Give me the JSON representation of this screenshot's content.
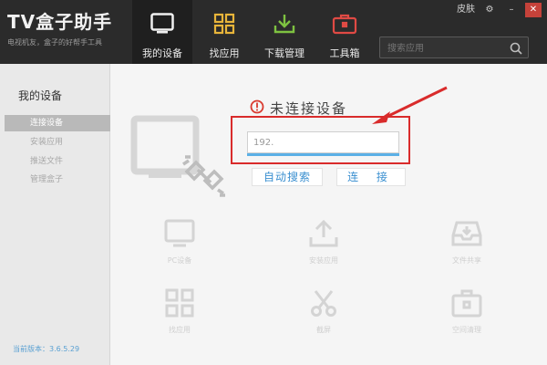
{
  "app": {
    "title": "TV盒子助手",
    "subtitle": "电视机友，盒子的好帮手工具"
  },
  "nav": {
    "tabs": [
      {
        "label": "我的设备",
        "icon": "monitor-icon"
      },
      {
        "label": "找应用",
        "icon": "apps-grid-icon"
      },
      {
        "label": "下载管理",
        "icon": "download-icon"
      },
      {
        "label": "工具箱",
        "icon": "toolbox-icon"
      }
    ],
    "active_tab": "我的设备"
  },
  "window_controls": {
    "skin_label": "皮肤",
    "settings": "⚙",
    "minimize": "–",
    "close": "✕"
  },
  "search": {
    "placeholder": "搜索应用"
  },
  "sidebar": {
    "title": "我的设备",
    "items": [
      {
        "label": "连接设备"
      },
      {
        "label": "安装应用"
      },
      {
        "label": "推送文件"
      },
      {
        "label": "管理盒子"
      }
    ],
    "active_item": "连接设备",
    "version": "当前版本：3.6.5.29"
  },
  "main": {
    "status_text": "未连接设备",
    "ip_value": "192.",
    "auto_search_label": "自动搜索",
    "connect_label": "连 接",
    "features": [
      {
        "label": "PC设备",
        "icon": "monitor-icon"
      },
      {
        "label": "安装应用",
        "icon": "upload-icon"
      },
      {
        "label": "文件共享",
        "icon": "inbox-icon"
      },
      {
        "label": "找应用",
        "icon": "apps-grid-icon"
      },
      {
        "label": "截屏",
        "icon": "scissors-icon"
      },
      {
        "label": "空间清理",
        "icon": "toolbox-icon"
      }
    ]
  },
  "colors": {
    "header_bg": "#2b2b2b",
    "sidebar_bg": "#e9e9e9",
    "accent_blue": "#3a8fd0",
    "highlight_red": "#d92b2b",
    "tab_active_bg": "#1f1f1f"
  }
}
